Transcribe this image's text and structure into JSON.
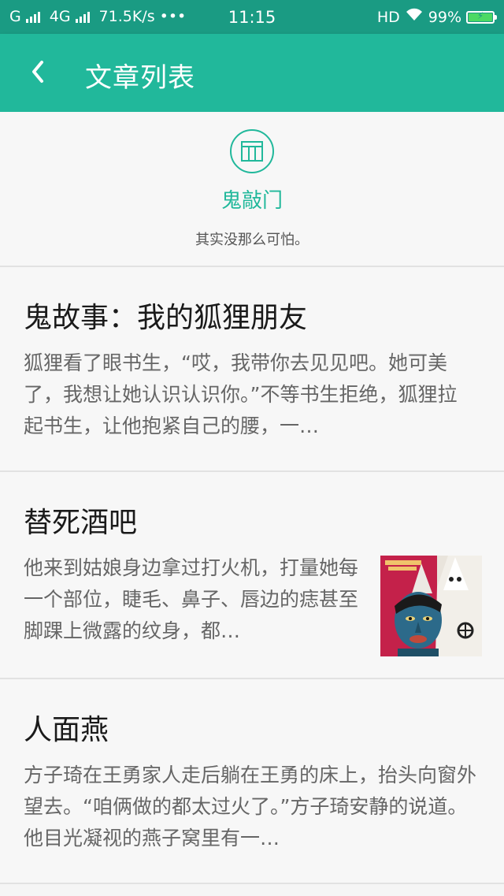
{
  "status_bar": {
    "carrier1": "G",
    "carrier2": "4G",
    "speed": "71.5K/s",
    "more": "•••",
    "time": "11:15",
    "hd": "HD",
    "battery": "99%",
    "battery_level": 0.99
  },
  "app_bar": {
    "back_icon": "chevron-left-icon",
    "title": "文章列表"
  },
  "header": {
    "icon": "book-icon",
    "name": "鬼敲门",
    "desc": "其实没那么可怕。"
  },
  "articles": [
    {
      "title": "鬼故事：我的狐狸朋友",
      "excerpt": "狐狸看了眼书生，“哎，我带你去见见吧。她可美了，我想让她认识认识你。”不等书生拒绝，狐狸拉起书生，让他抱紧自己的腰，一…"
    },
    {
      "title": "替死酒吧",
      "excerpt": "他来到姑娘身边拿过打火机，打量她每一个部位，睫毛、鼻子、唇边的痣甚至脚踝上微露的纹身，都…",
      "thumbnail": "article-thumbnail"
    },
    {
      "title": "人面燕",
      "excerpt": "方子琦在王勇家人走后躺在王勇的床上，抬头向窗外望去。“咱俩做的都太过火了。”方子琦安静的说道。他目光凝视的燕子窝里有一…"
    }
  ],
  "colors": {
    "status_bar": "#1a9b83",
    "app_bar": "#21b89b",
    "accent": "#21b89b",
    "title_text": "#1a1a1a",
    "body_text": "#666666"
  }
}
